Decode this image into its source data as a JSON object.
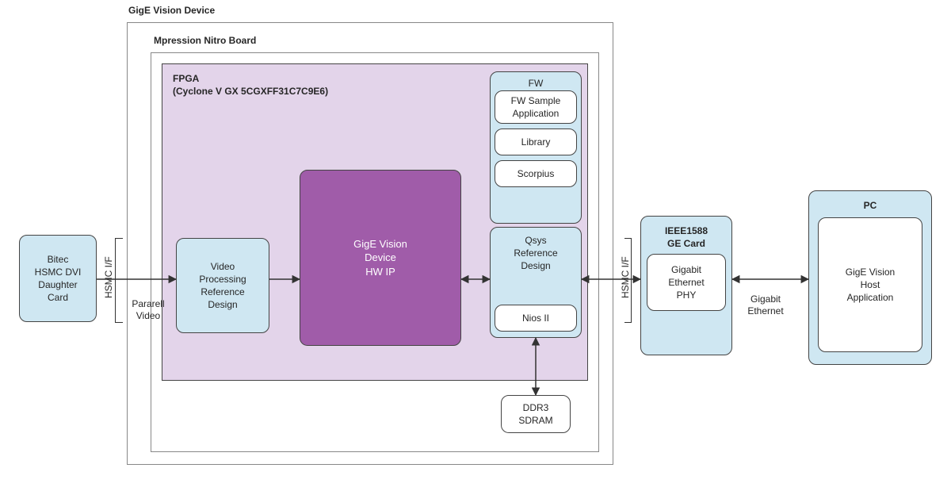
{
  "titles": {
    "device": "GigE Vision Device",
    "nitro": "Mpression Nitro Board",
    "fpga_line1": "FPGA",
    "fpga_line2": "(Cyclone V GX 5CGXFF31C7C9E6)"
  },
  "blocks": {
    "bitec": "Bitec\nHSMC DVI\nDaughter\nCard",
    "video_proc": "Video\nProcessing\nReference\nDesign",
    "hw_ip": "GigE Vision\nDevice\nHW IP",
    "fw": "FW",
    "fw_app": "FW Sample\nApplication",
    "library": "Library",
    "scorpius": "Scorpius",
    "qsys": "Qsys\nReference\nDesign",
    "nios": "Nios II",
    "ddr3": "DDR3\nSDRAM",
    "ieee_title": "IEEE1588\nGE Card",
    "gbe_phy": "Gigabit\nEthernet\nPHY",
    "pc_title": "PC",
    "pc_app": "GigE Vision\nHost\nApplication"
  },
  "conn": {
    "hsmc_if_left": "HSMC I/F",
    "pararell_video": "Pararell\nVideo",
    "hsmc_if_right": "HSMC I/F",
    "gigabit_ethernet": "Gigabit\nEthernet"
  }
}
